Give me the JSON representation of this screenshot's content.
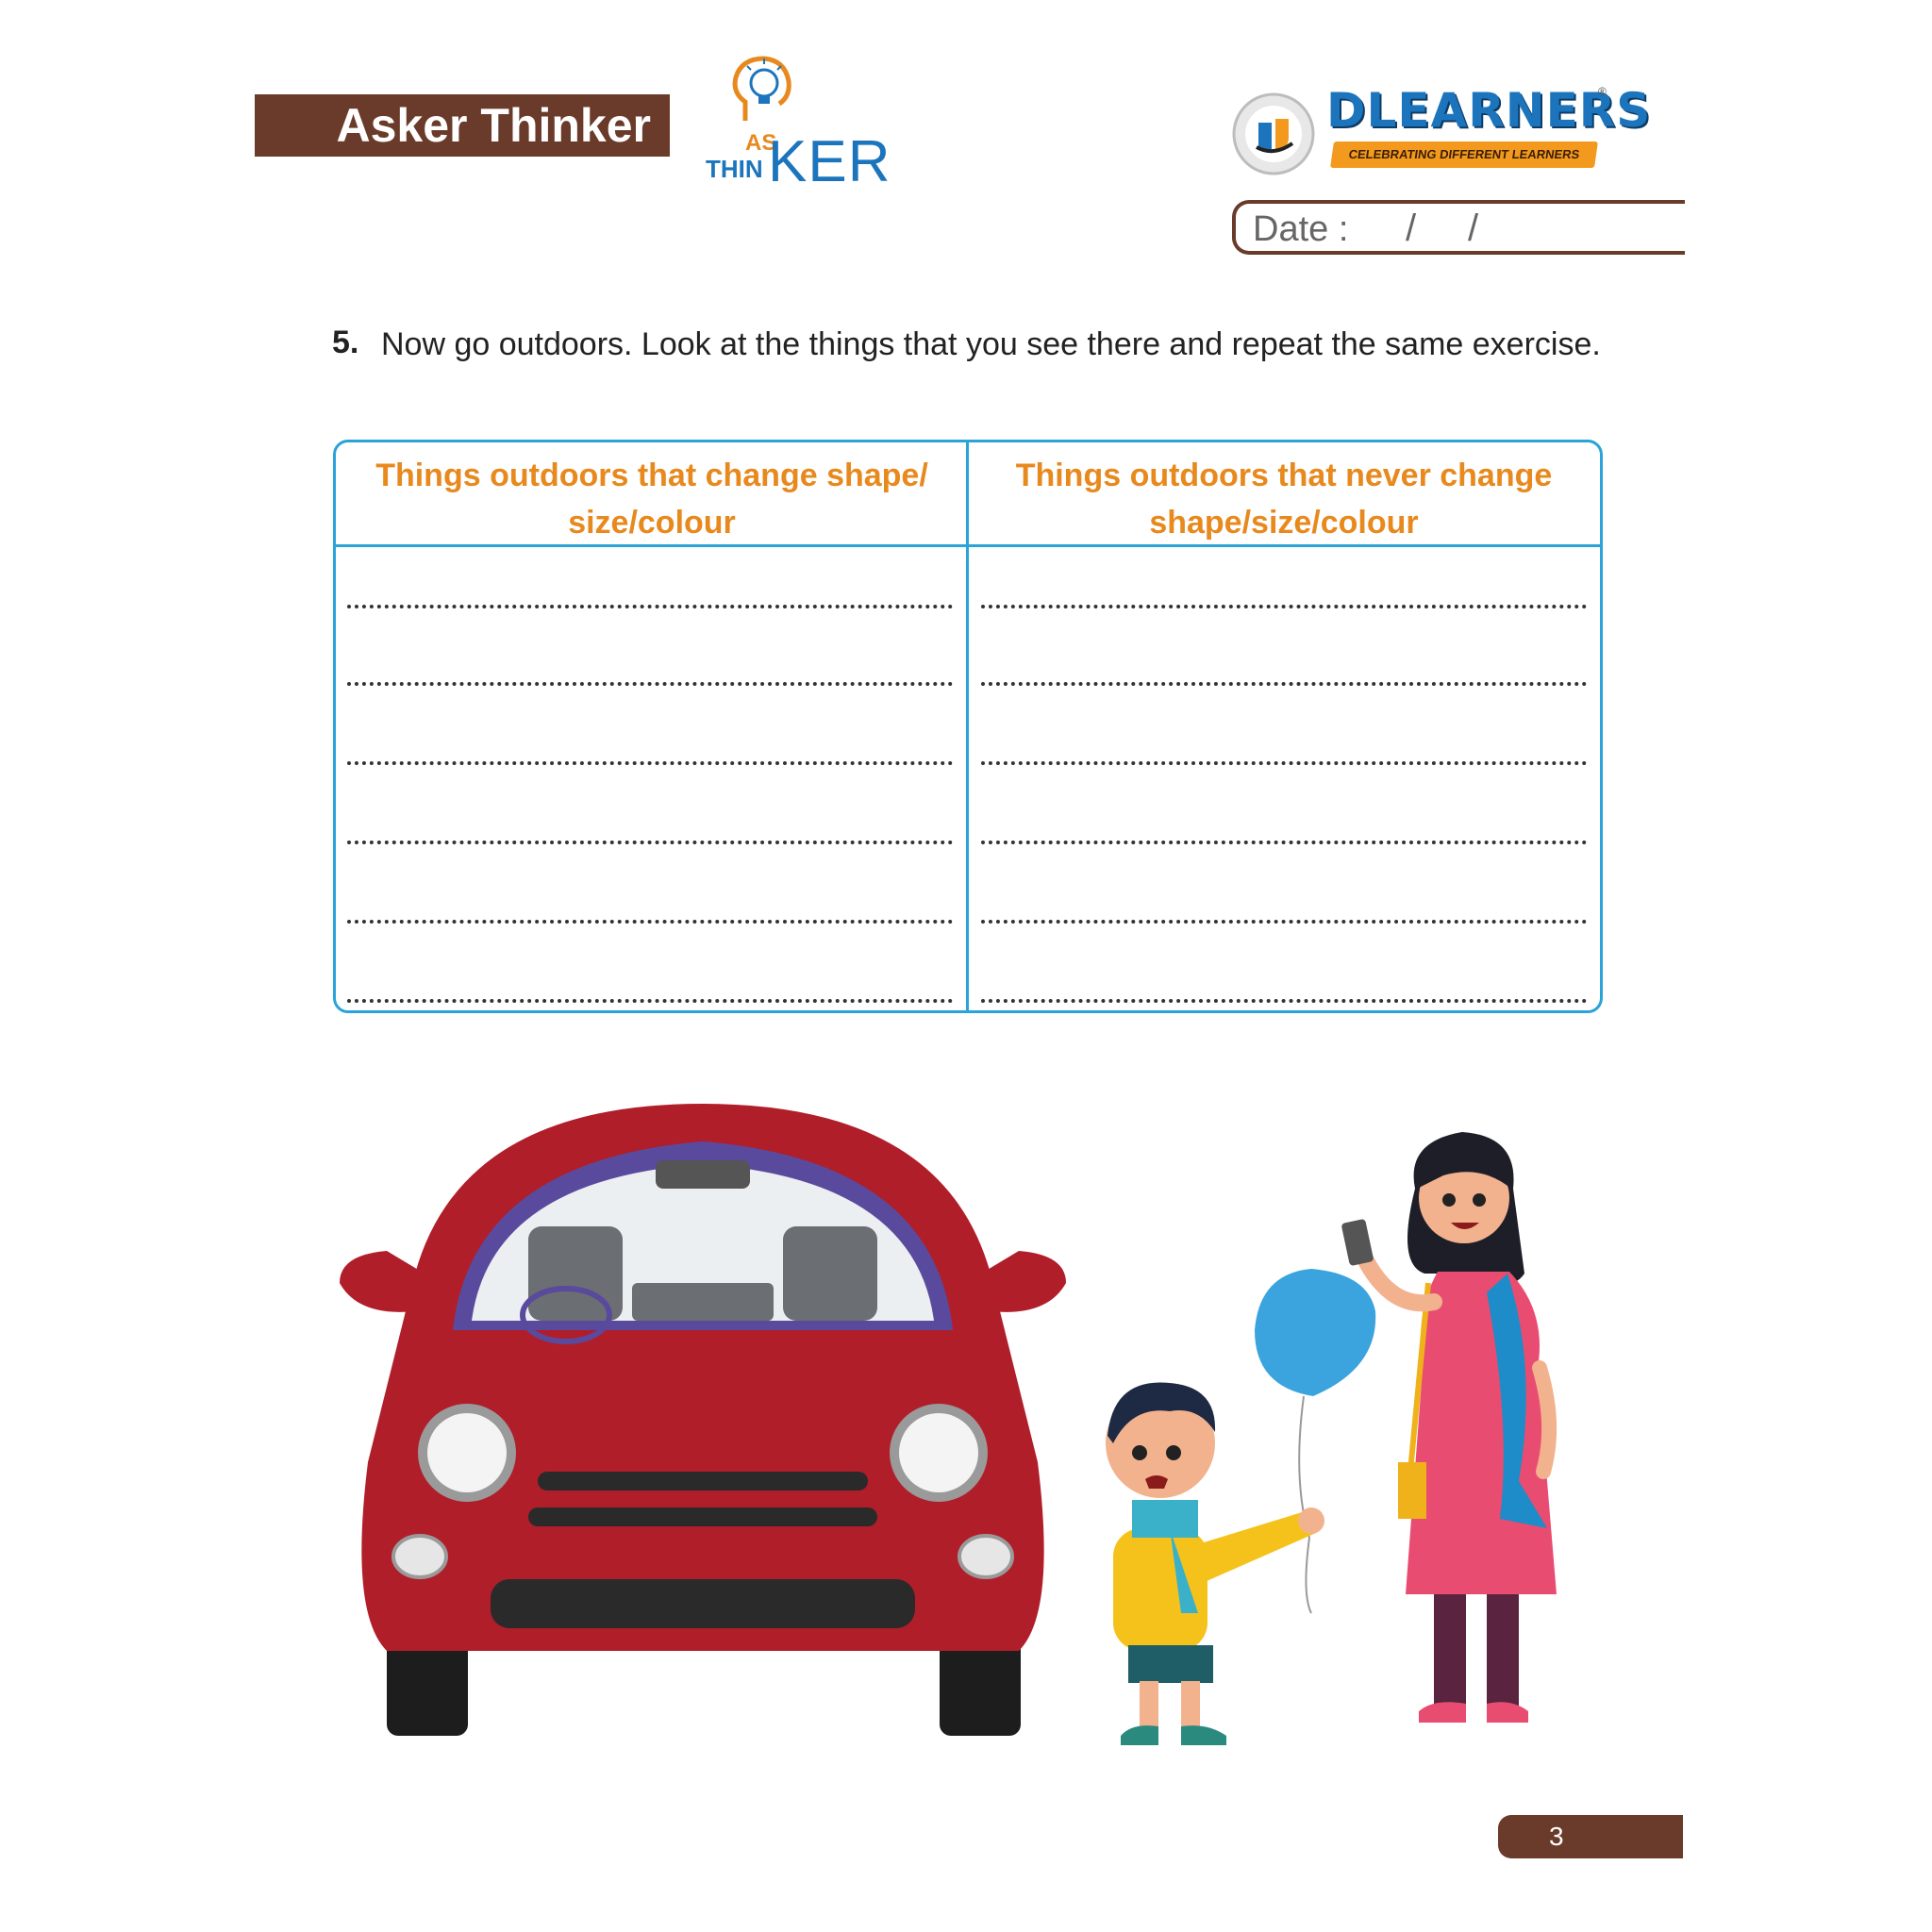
{
  "header": {
    "banner_title": "Asker Thinker",
    "asker_logo": {
      "as": "AS",
      "thin": "THIN",
      "ker": "KER",
      "icon": "lightbulb-head-icon"
    },
    "dlearners_logo": {
      "name": "DLEARNERS",
      "tagline": "CELEBRATING DIFFERENT LEARNERS",
      "reg": "®"
    },
    "date": {
      "label": "Date :",
      "slash": "/"
    }
  },
  "question": {
    "number": "5.",
    "text": "Now go outdoors. Look at the things that you see there and repeat the same exercise."
  },
  "table": {
    "headers": [
      "Things outdoors that change shape/ size/colour",
      "Things outdoors that never change shape/size/colour"
    ],
    "rows_per_column": 6
  },
  "illustration": {
    "items": [
      "red-car",
      "boy-with-balloon",
      "woman-with-phone"
    ]
  },
  "colors": {
    "brown": "#6a3b2a",
    "orange": "#e8891e",
    "blue": "#29a3d8",
    "car_red": "#b01e2a"
  },
  "footer": {
    "page_number": "3"
  }
}
